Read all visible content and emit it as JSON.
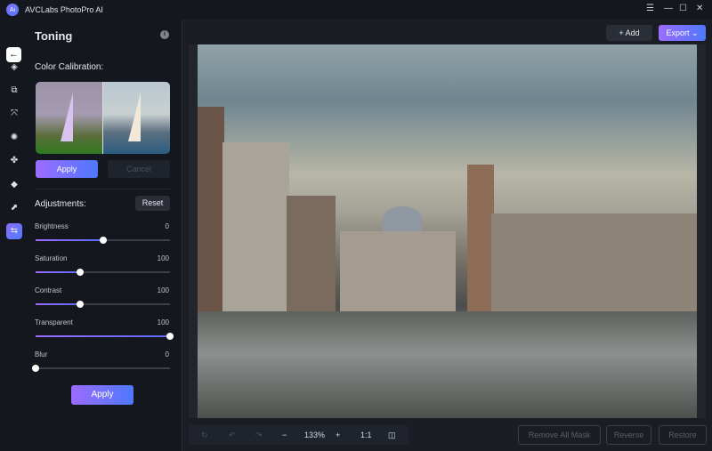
{
  "app": {
    "title": "AVCLabs PhotoPro AI",
    "logo_text": "Ai"
  },
  "window_controls": [
    "menu-icon",
    "minimize-icon",
    "maximize-icon",
    "close-icon"
  ],
  "rail": {
    "items": [
      "eraser-icon",
      "replace-icon",
      "expand-icon",
      "face-icon",
      "enhance-icon",
      "colorize-icon",
      "upscale-icon",
      "toning-icon"
    ],
    "active": "toning-icon"
  },
  "panel": {
    "title": "Toning",
    "color_calibration": "Color Calibration:",
    "apply": "Apply",
    "cancel": "Cancel",
    "adjustments": "Adjustments:",
    "reset": "Reset",
    "sliders": [
      {
        "label": "Brightness",
        "value": "0",
        "fill": 0.5
      },
      {
        "label": "Saturation",
        "value": "100",
        "fill": 0.33
      },
      {
        "label": "Contrast",
        "value": "100",
        "fill": 0.33
      },
      {
        "label": "Transparent",
        "value": "100",
        "fill": 1.0
      },
      {
        "label": "Blur",
        "value": "0",
        "fill": 0.0
      }
    ],
    "apply_bottom": "Apply"
  },
  "toolbar": {
    "add": "+ Add",
    "export": "Export"
  },
  "bottom": {
    "zoom": "133%",
    "minus": "−",
    "plus": "+",
    "one_to_one": "1:1",
    "remove_all_mask": "Remove All Mask",
    "reverse": "Reverse",
    "restore": "Restore"
  },
  "colors": {
    "accent_start": "#9b6cff",
    "accent_end": "#4f78ff",
    "bg": "#14171d"
  }
}
